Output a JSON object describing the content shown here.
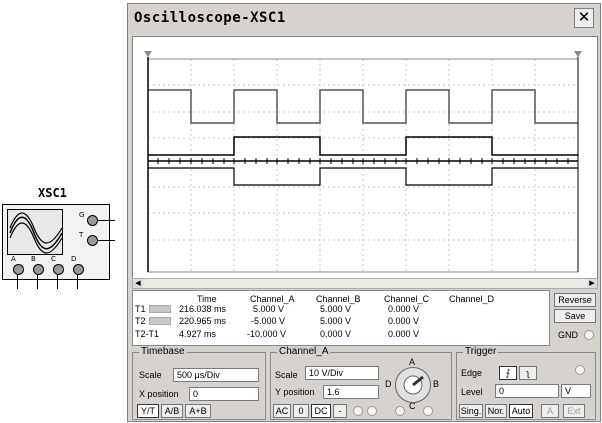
{
  "symbol": {
    "name": "XSC1",
    "terminals": [
      "G",
      "T",
      "A",
      "B",
      "C",
      "D"
    ]
  },
  "window": {
    "title": "Oscilloscope-XSC1",
    "close_glyph": "✕"
  },
  "readout": {
    "headers": [
      "Time",
      "Channel_A",
      "Channel_B",
      "Channel_C",
      "Channel_D"
    ],
    "rows": [
      {
        "label": "T1",
        "time": "216.038 ms",
        "a": "5.000 V",
        "b": "5.000 V",
        "c": "0.000 V",
        "d": ""
      },
      {
        "label": "T2",
        "time": "220.965 ms",
        "a": "-5.000 V",
        "b": "5.000 V",
        "c": "0.000 V",
        "d": ""
      },
      {
        "label": "T2-T1",
        "time": "4.927 ms",
        "a": "-10.000 V",
        "b": "0.000 V",
        "c": "0.000 V",
        "d": ""
      }
    ],
    "reverse": "Reverse",
    "save": "Save",
    "gnd": "GND"
  },
  "timebase": {
    "label": "Timebase",
    "scale_label": "Scale",
    "scale_value": "500 μs/Div",
    "xpos_label": "X position",
    "xpos_value": "0",
    "modes": [
      "Y/T",
      "A/B",
      "A+B"
    ]
  },
  "channel": {
    "label": "Channel_A",
    "scale_label": "Scale",
    "scale_value": "10  V/Div",
    "ypos_label": "Y position",
    "ypos_value": "1.6",
    "coupling": [
      "AC",
      "0",
      "DC",
      "-"
    ],
    "knob_labels": [
      "A",
      "B",
      "C",
      "D"
    ]
  },
  "trigger": {
    "label": "Trigger",
    "edge_label": "Edge",
    "level_label": "Level",
    "level_value": "0",
    "level_unit": "V",
    "modes": [
      "Sing.",
      "Nor.",
      "Auto"
    ],
    "sources": [
      "A",
      "Ext"
    ]
  }
}
